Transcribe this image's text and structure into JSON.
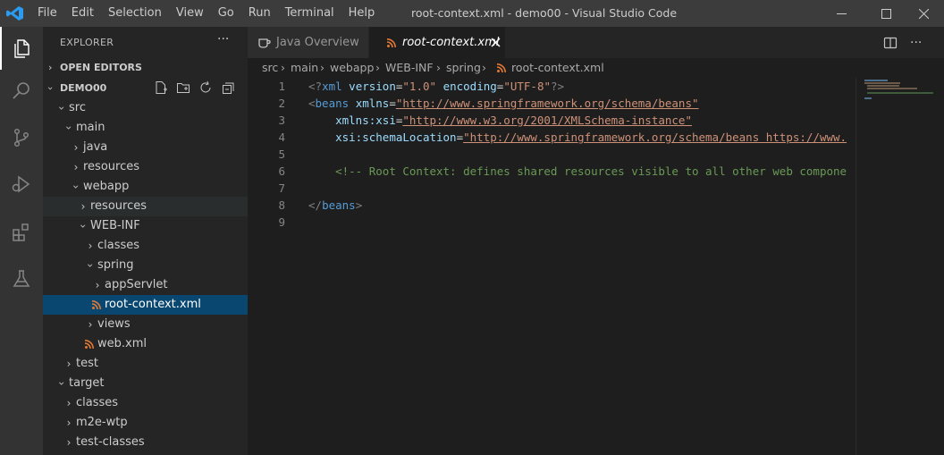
{
  "titlebar": {
    "menu": [
      "File",
      "Edit",
      "Selection",
      "View",
      "Go",
      "Run",
      "Terminal",
      "Help"
    ],
    "title": "root-context.xml - demo00 - Visual Studio Code"
  },
  "activity_bar": [
    "explorer-icon",
    "search-icon",
    "source-control-icon",
    "run-debug-icon",
    "extensions-icon",
    "testing-icon"
  ],
  "sidebar": {
    "title": "EXPLORER",
    "more": "···",
    "open_editors": "OPEN EDITORS",
    "workspace": "DEMO00",
    "tree": [
      {
        "label": "src",
        "depth": 0,
        "expanded": true
      },
      {
        "label": "main",
        "depth": 1,
        "expanded": true
      },
      {
        "label": "java",
        "depth": 2,
        "expanded": false
      },
      {
        "label": "resources",
        "depth": 2,
        "expanded": false
      },
      {
        "label": "webapp",
        "depth": 2,
        "expanded": true
      },
      {
        "label": "resources",
        "depth": 3,
        "expanded": false
      },
      {
        "label": "WEB-INF",
        "depth": 3,
        "expanded": true
      },
      {
        "label": "classes",
        "depth": 4,
        "expanded": false
      },
      {
        "label": "spring",
        "depth": 4,
        "expanded": true
      },
      {
        "label": "appServlet",
        "depth": 5,
        "expanded": false
      },
      {
        "label": "root-context.xml",
        "depth": 5,
        "file": true
      },
      {
        "label": "views",
        "depth": 4,
        "expanded": false
      },
      {
        "label": "web.xml",
        "depth": 4,
        "file": true
      },
      {
        "label": "test",
        "depth": 1,
        "expanded": false
      },
      {
        "label": "target",
        "depth": 0,
        "expanded": true
      },
      {
        "label": "classes",
        "depth": 1,
        "expanded": false
      },
      {
        "label": "m2e-wtp",
        "depth": 1,
        "expanded": false
      },
      {
        "label": "test-classes",
        "depth": 1,
        "expanded": false
      }
    ]
  },
  "tabs": [
    {
      "label": "Java Overview",
      "active": false
    },
    {
      "label": "root-context.xml",
      "active": true
    }
  ],
  "breadcrumb": [
    "src",
    "main",
    "webapp",
    "WEB-INF",
    "spring",
    "root-context.xml"
  ],
  "editor": {
    "line_numbers": [
      "1",
      "2",
      "3",
      "4",
      "5",
      "6",
      "7",
      "8",
      "9"
    ],
    "lines": [
      [
        [
          "pun",
          "<"
        ],
        [
          "pun",
          "?"
        ],
        [
          "tag",
          "xml "
        ],
        [
          "attr",
          "version"
        ],
        [
          "txt",
          "="
        ],
        [
          "str",
          "\"1.0\""
        ],
        [
          "txt",
          " "
        ],
        [
          "attr",
          "encoding"
        ],
        [
          "txt",
          "="
        ],
        [
          "str",
          "\"UTF-8\""
        ],
        [
          "pun",
          "?"
        ],
        [
          "pun",
          ">"
        ]
      ],
      [
        [
          "pun",
          "<"
        ],
        [
          "tag",
          "beans "
        ],
        [
          "attr",
          "xmlns"
        ],
        [
          "txt",
          "="
        ],
        [
          "str",
          "\"http://www.springframework.org/schema/beans\""
        ]
      ],
      [
        [
          "txt",
          "    "
        ],
        [
          "attr",
          "xmlns:xsi"
        ],
        [
          "txt",
          "="
        ],
        [
          "str",
          "\"http://www.w3.org/2001/XMLSchema-instance\""
        ]
      ],
      [
        [
          "txt",
          "    "
        ],
        [
          "attr",
          "xsi:schemaLocation"
        ],
        [
          "txt",
          "="
        ],
        [
          "str",
          "\"http://www.springframework.org/schema/beans https://www."
        ]
      ],
      [],
      [
        [
          "txt",
          "    "
        ],
        [
          "cm",
          "<!-- Root Context: defines shared resources visible to all other web compone"
        ]
      ],
      [],
      [
        [
          "pun",
          "</"
        ],
        [
          "tag",
          "beans"
        ],
        [
          "pun",
          ">"
        ]
      ],
      []
    ]
  },
  "colors": {
    "accent": "#007acc",
    "selected_row": "#094771",
    "xml_icon": "#e37933"
  }
}
